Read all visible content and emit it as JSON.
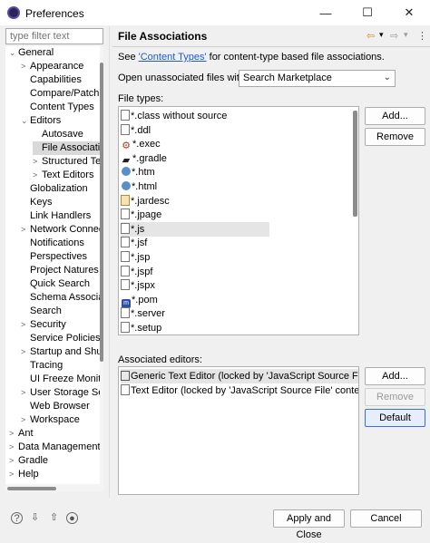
{
  "window": {
    "title": "Preferences",
    "minimize": "—",
    "maximize": "☐",
    "close": "✕"
  },
  "filter": {
    "placeholder": "type filter text"
  },
  "tree": {
    "items": [
      {
        "label": "General",
        "tw": "⌄"
      },
      {
        "label": "Appearance",
        "tw": ">"
      },
      {
        "label": "Capabilities",
        "tw": ""
      },
      {
        "label": "Compare/Patch",
        "tw": ""
      },
      {
        "label": "Content Types",
        "tw": ""
      },
      {
        "label": "Editors",
        "tw": "⌄"
      },
      {
        "label": "Autosave",
        "tw": ""
      },
      {
        "label": "File Associations",
        "tw": ""
      },
      {
        "label": "Structured Text Editors",
        "tw": ">"
      },
      {
        "label": "Text Editors",
        "tw": ">"
      },
      {
        "label": "Globalization",
        "tw": ""
      },
      {
        "label": "Keys",
        "tw": ""
      },
      {
        "label": "Link Handlers",
        "tw": ""
      },
      {
        "label": "Network Connections",
        "tw": ">"
      },
      {
        "label": "Notifications",
        "tw": ""
      },
      {
        "label": "Perspectives",
        "tw": ""
      },
      {
        "label": "Project Natures",
        "tw": ""
      },
      {
        "label": "Quick Search",
        "tw": ""
      },
      {
        "label": "Schema Associations",
        "tw": ""
      },
      {
        "label": "Search",
        "tw": ""
      },
      {
        "label": "Security",
        "tw": ">"
      },
      {
        "label": "Service Policies",
        "tw": ""
      },
      {
        "label": "Startup and Shutdown",
        "tw": ">"
      },
      {
        "label": "Tracing",
        "tw": ""
      },
      {
        "label": "UI Freeze Monitoring",
        "tw": ""
      },
      {
        "label": "User Storage Service",
        "tw": ">"
      },
      {
        "label": "Web Browser",
        "tw": ""
      },
      {
        "label": "Workspace",
        "tw": ">"
      },
      {
        "label": "Ant",
        "tw": ">"
      },
      {
        "label": "Data Management",
        "tw": ">"
      },
      {
        "label": "Gradle",
        "tw": ">"
      },
      {
        "label": "Help",
        "tw": ">"
      }
    ]
  },
  "page": {
    "title": "File Associations",
    "info_prefix": "See ",
    "info_link": "'Content Types'",
    "info_suffix": " for content-type based file associations.",
    "open_label": "Open unassociated files with:",
    "open_value": "Search Marketplace",
    "file_types_label": "File types:",
    "assoc_label": "Associated editors:"
  },
  "file_types": [
    {
      "name": "*.class without source",
      "icon": "doc"
    },
    {
      "name": "*.ddl",
      "icon": "doc"
    },
    {
      "name": "*.exec",
      "icon": "gear"
    },
    {
      "name": "*.gradle",
      "icon": "gradle"
    },
    {
      "name": "*.htm",
      "icon": "globe"
    },
    {
      "name": "*.html",
      "icon": "globe"
    },
    {
      "name": "*.jardesc",
      "icon": "jar"
    },
    {
      "name": "*.jpage",
      "icon": "doc"
    },
    {
      "name": "*.js",
      "icon": "doc"
    },
    {
      "name": "*.jsf",
      "icon": "doc"
    },
    {
      "name": "*.jsp",
      "icon": "doc"
    },
    {
      "name": "*.jspf",
      "icon": "doc"
    },
    {
      "name": "*.jspx",
      "icon": "doc"
    },
    {
      "name": "*.pom",
      "icon": "pom"
    },
    {
      "name": "*.server",
      "icon": "doc"
    },
    {
      "name": "*.setup",
      "icon": "doc"
    }
  ],
  "editors": [
    {
      "name": "Generic Text Editor (locked by 'JavaScript Source File' content type)",
      "icon": "app"
    },
    {
      "name": "Text Editor (locked by 'JavaScript Source File' content type)",
      "icon": "doc"
    }
  ],
  "buttons": {
    "add1": "Add...",
    "remove1": "Remove",
    "add2": "Add...",
    "remove2": "Remove",
    "default": "Default",
    "apply_close": "Apply and Close",
    "cancel": "Cancel"
  },
  "nav": {
    "back": "⇦",
    "back_menu": "▾",
    "forward": "⇨",
    "forward_menu": "▾",
    "menu": "⋮"
  },
  "footer_icons": [
    "help-icon",
    "import-icon",
    "export-icon",
    "record-icon"
  ]
}
